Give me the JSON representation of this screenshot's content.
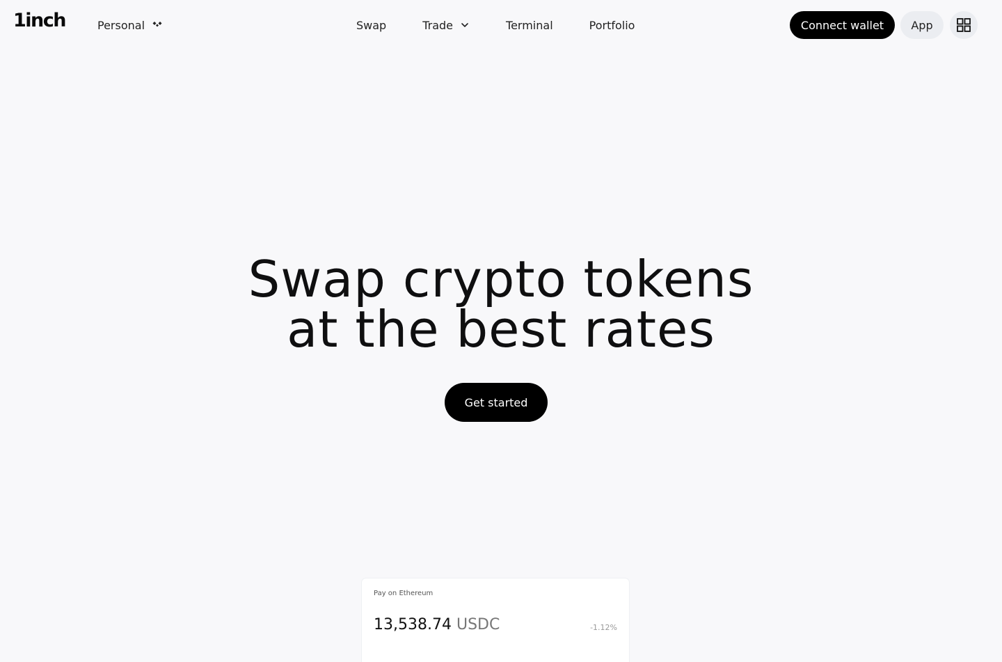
{
  "header": {
    "logo": "1inch",
    "profile": {
      "label": "Personal",
      "icon": "diamond-cluster-icon"
    },
    "nav": [
      {
        "label": "Swap"
      },
      {
        "label": "Trade",
        "icon": "chevron-down-icon"
      },
      {
        "label": "Terminal"
      },
      {
        "label": "Portfolio"
      }
    ],
    "connect_wallet_label": "Connect wallet",
    "app_label": "App",
    "grid_icon": "grid-icon"
  },
  "hero": {
    "title_line1": "Swap crypto tokens",
    "title_line2": "at the best rates",
    "cta_label": "Get started"
  },
  "swap_card": {
    "label": "Pay on Ethereum",
    "amount": "13,538.74",
    "token": "USDC",
    "delta": "-1.12%"
  },
  "colors": {
    "background": "#f8f8fa",
    "primary_button": "#000000",
    "secondary_button": "#ebedf1",
    "text": "#111111"
  }
}
